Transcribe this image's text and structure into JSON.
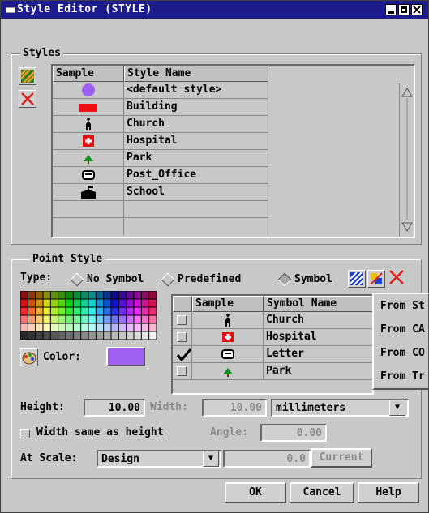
{
  "window": {
    "title": "Style Editor (STYLE)"
  },
  "styles_group": {
    "label": "Styles",
    "headers": {
      "sample": "Sample",
      "name": "Style Name"
    },
    "rows": [
      {
        "name": "<default style>",
        "icon": "purple-circle-icon"
      },
      {
        "name": "Building",
        "icon": "red-rectangle-icon"
      },
      {
        "name": "Church",
        "icon": "church-icon"
      },
      {
        "name": "Hospital",
        "icon": "hospital-icon"
      },
      {
        "name": "Park",
        "icon": "park-tree-icon"
      },
      {
        "name": "Post_Office",
        "icon": "mailbox-icon"
      },
      {
        "name": "School",
        "icon": "school-icon"
      }
    ]
  },
  "point_style": {
    "label": "Point Style",
    "type_label": "Type:",
    "type_options": [
      "No Symbol",
      "Predefined",
      "Symbol"
    ],
    "color_label": "Color:",
    "color_value": "#a060f0",
    "symbol_table": {
      "headers": {
        "sample": "Sample",
        "name": "Symbol Name"
      },
      "rows": [
        {
          "name": "Church",
          "checked": false,
          "icon": "church-icon"
        },
        {
          "name": "Hospital",
          "checked": false,
          "icon": "hospital-icon"
        },
        {
          "name": "Letter",
          "checked": true,
          "icon": "mailbox-icon"
        },
        {
          "name": "Park",
          "checked": false,
          "icon": "park-tree-icon"
        }
      ]
    },
    "popup_menu": [
      "From St",
      "From CA",
      "From CO",
      "From Tr"
    ],
    "height_label": "Height:",
    "height_value": "10.00",
    "width_label": "Width:",
    "width_value": "10.00",
    "units": "millimeters",
    "same_as_height_label": "Width same as height",
    "angle_label": "Angle:",
    "angle_value": "0.00",
    "scale_label": "At Scale:",
    "scale_value": "Design",
    "scale_number": "0.0",
    "current_label": "Current"
  },
  "buttons": {
    "ok": "OK",
    "cancel": "Cancel",
    "help": "Help"
  }
}
